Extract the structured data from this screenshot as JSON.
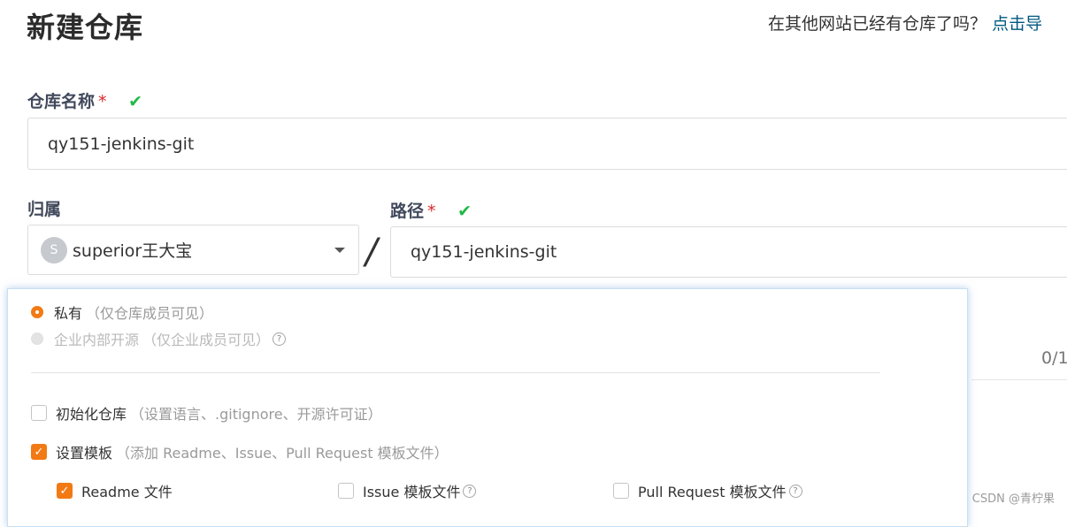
{
  "header": {
    "title": "新建仓库",
    "import_question": "在其他网站已经有仓库了吗？",
    "import_link": "点击导"
  },
  "form": {
    "name_label": "仓库名称",
    "required_mark": "*",
    "valid_mark": "✔",
    "name_value": "qy151-jenkins-git",
    "owner_label": "归属",
    "owner_avatar_letter": "S",
    "owner_value": "superior王大宝",
    "separator": "/",
    "path_label": "路径",
    "path_value": "qy151-jenkins-git",
    "counter": "0/1"
  },
  "visibility": {
    "private_label": "私有",
    "private_hint": "（仅仓库成员可见）",
    "enterprise_label": "企业内部开源",
    "enterprise_hint": "（仅企业成员可见）"
  },
  "options": {
    "init_label": "初始化仓库",
    "init_hint": "（设置语言、.gitignore、开源许可证）",
    "template_label": "设置模板",
    "template_hint": "（添加 Readme、Issue、Pull Request 模板文件）",
    "readme_label": "Readme 文件",
    "issue_label": "Issue 模板文件",
    "pr_label": "Pull Request 模板文件"
  },
  "icons": {
    "help": "?",
    "check": "✓"
  },
  "watermark": "CSDN @青柠果",
  "colors": {
    "accent": "#f27a14",
    "valid": "#21ba45",
    "required": "#db2828",
    "link": "#005980"
  }
}
